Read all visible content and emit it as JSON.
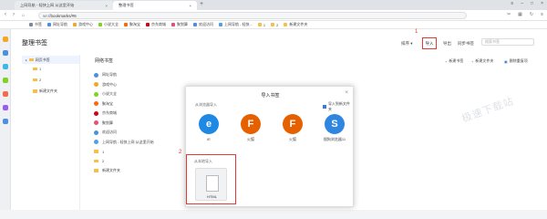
{
  "tabs": [
    {
      "label": "上网导航 - 轻快上网 从这里开始",
      "active": false
    },
    {
      "label": "整理书签",
      "active": true
    }
  ],
  "address": {
    "scheme": "se://",
    "path": "bookmarks/#6"
  },
  "bookmarks_bar": [
    {
      "label": "书签",
      "color": "#7a8aa0"
    },
    {
      "label": "网址导航",
      "color": "#4a90e2"
    },
    {
      "label": "游戏中心",
      "color": "#f5a623"
    },
    {
      "label": "小说大全",
      "color": "#7ed321"
    },
    {
      "label": "聚淘宝",
      "color": "#ff6a00"
    },
    {
      "label": "京东商城",
      "color": "#d0021b"
    },
    {
      "label": "聚划算",
      "color": "#e94e77"
    },
    {
      "label": "欢迎访问",
      "color": "#4a90e2"
    },
    {
      "label": "上网导航 - 轻快...",
      "color": "#50a0e8"
    },
    {
      "label": "1",
      "color": "#f5c044"
    },
    {
      "label": "2",
      "color": "#f5c044"
    },
    {
      "label": "新建文件夹",
      "color": "#f5c044"
    }
  ],
  "header": {
    "title": "整理书签",
    "sort_label": "排序 ▾",
    "import_label": "导入",
    "export_label": "导出",
    "sync_label": "同步书签",
    "search_placeholder": "搜索书签",
    "step1": "1",
    "step2": "2"
  },
  "tree": {
    "root": "网页书签",
    "children": [
      "1",
      "2",
      "新建文件夹"
    ]
  },
  "list": {
    "title": "网络书签",
    "add_bookmark": "新建书签",
    "add_folder": "新建文件夹",
    "delete_dup": "删除重复项",
    "rows": [
      {
        "label": "网址导航",
        "color": "#4a90e2"
      },
      {
        "label": "游戏中心",
        "color": "#f5a623"
      },
      {
        "label": "小说大全",
        "color": "#7ed321"
      },
      {
        "label": "聚淘宝",
        "color": "#ff6a00"
      },
      {
        "label": "京东商城",
        "color": "#d0021b"
      },
      {
        "label": "聚划算",
        "color": "#e94e77"
      },
      {
        "label": "欢迎访问",
        "color": "#4a90e2"
      },
      {
        "label": "上网导航 - 轻快上网 从这里开始",
        "color": "#50a0e8"
      },
      {
        "label": "1",
        "color": "#f5c044"
      },
      {
        "label": "2",
        "color": "#f5c044"
      },
      {
        "label": "新建文件夹",
        "color": "#f5c044"
      }
    ]
  },
  "modal": {
    "title": "导入书签",
    "from_browser_label": "从浏览器导入",
    "import_new_folder": "导入到新文件夹",
    "browsers": [
      {
        "name": "IE",
        "color": "#1e88e5",
        "glyph": "e"
      },
      {
        "name": "火狐",
        "color": "#e66000",
        "glyph": "F"
      },
      {
        "name": "火狐",
        "color": "#e66000",
        "glyph": "F"
      },
      {
        "name": "搜狗浏览器11",
        "color": "#2f86e0",
        "glyph": "S"
      }
    ],
    "from_file_label": "从本地导入",
    "html_label": "HTML"
  },
  "watermark": "极速下载站"
}
